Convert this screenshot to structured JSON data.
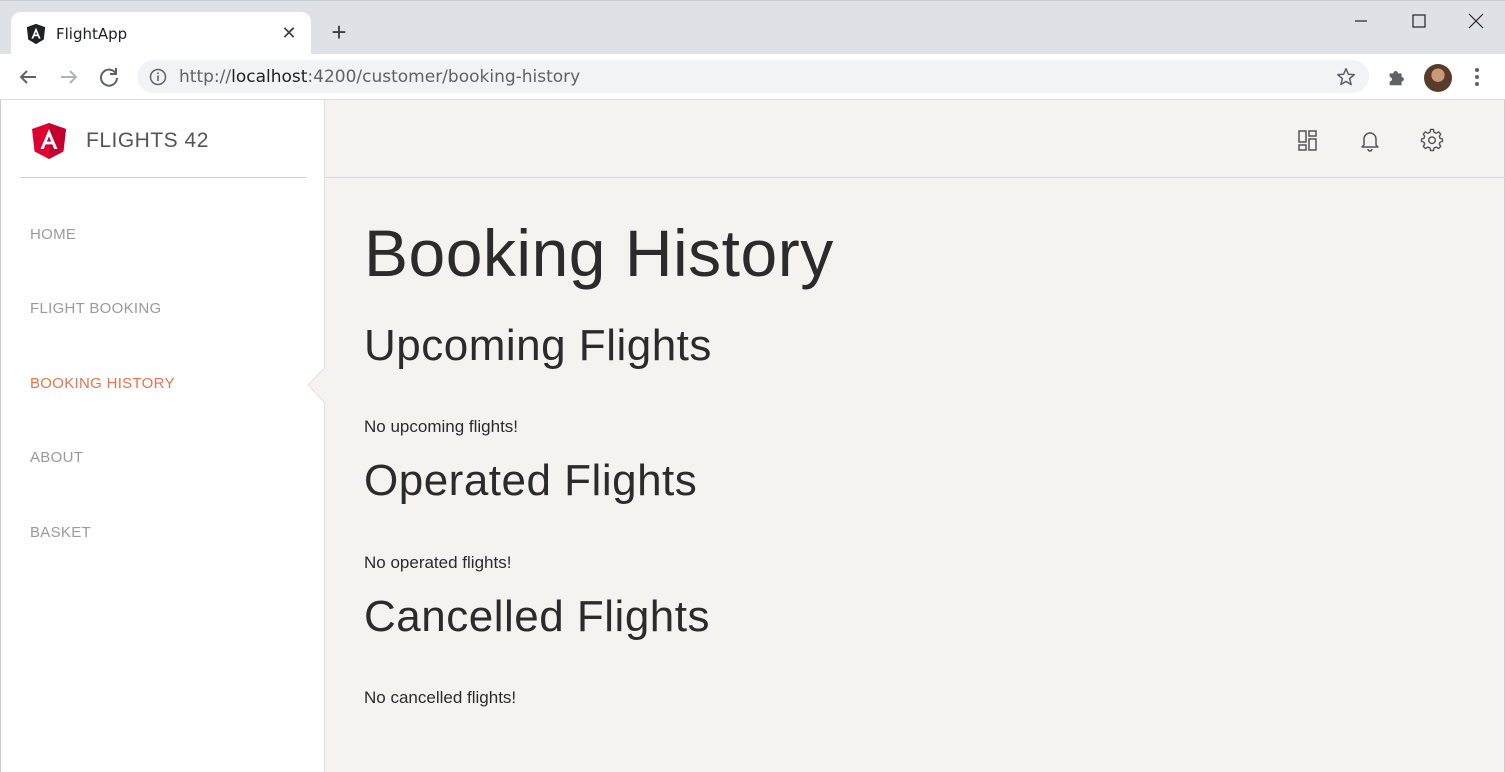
{
  "browser": {
    "tab_title": "FlightApp",
    "url_prefix": "http://",
    "url_host": "localhost",
    "url_rest": ":4200/customer/booking-history",
    "accent": "#e0754e"
  },
  "sidebar": {
    "brand": "FLIGHTS 42",
    "items": [
      {
        "label": "HOME"
      },
      {
        "label": "FLIGHT BOOKING"
      },
      {
        "label": "BOOKING HISTORY"
      },
      {
        "label": "ABOUT"
      },
      {
        "label": "BASKET"
      }
    ]
  },
  "topbar": {
    "icons": [
      "dashboard-icon",
      "bell-icon",
      "gear-icon"
    ]
  },
  "main": {
    "title": "Booking History",
    "sections": [
      {
        "heading": "Upcoming Flights",
        "empty": "No upcoming flights!"
      },
      {
        "heading": "Operated Flights",
        "empty": "No operated flights!"
      },
      {
        "heading": "Cancelled Flights",
        "empty": "No cancelled flights!"
      }
    ]
  }
}
